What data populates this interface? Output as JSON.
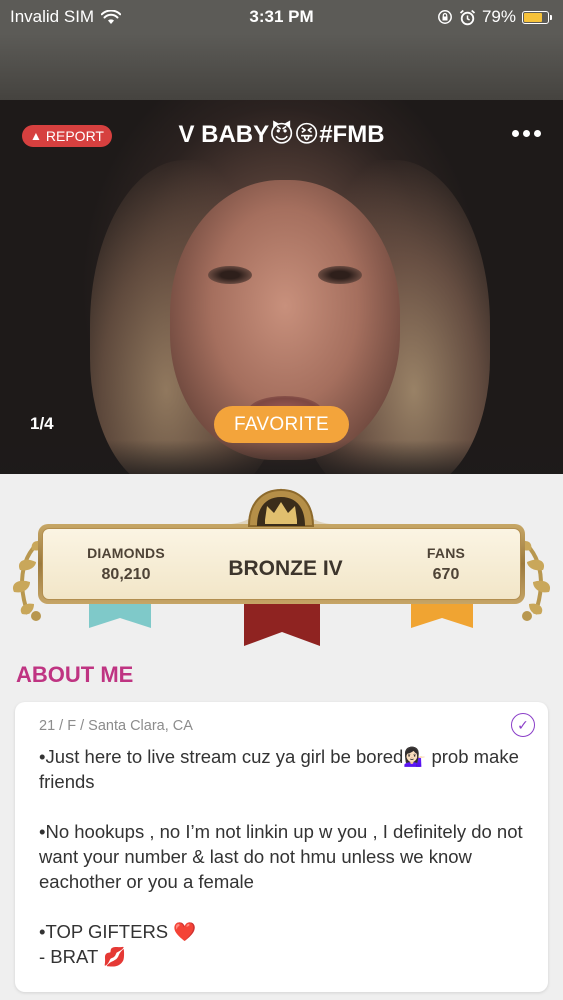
{
  "status_bar": {
    "carrier": "Invalid SIM",
    "time": "3:31 PM",
    "battery": "79%",
    "battery_level": 0.79,
    "icons": [
      "wifi-icon",
      "orientation-lock-icon",
      "alarm-icon",
      "battery-icon"
    ]
  },
  "profile": {
    "report_label": "REPORT",
    "display_name": "V BABY😈😝#FMB",
    "photo_counter": "1/4",
    "favorite_label": "FAVORITE"
  },
  "rank": {
    "diamonds_label": "DIAMONDS",
    "diamonds_value": "80,210",
    "tier": "BRONZE IV",
    "fans_label": "FANS",
    "fans_value": "670"
  },
  "about": {
    "heading": "ABOUT ME",
    "meta": "21 / F / Santa Clara, CA",
    "line1": "•Just here to live stream cuz ya girl be bored💁🏻‍♀️ prob make friends",
    "line2": "•No hookups , no I’m not linkin up w you , I definitely do not want your number & last do not hmu unless we know eachother or you a female",
    "line3": "•TOP GIFTERS ❤️",
    "line4": "- BRAT 💋"
  },
  "colors": {
    "report": "#d6403f",
    "favorite": "#f3a43b",
    "about_heading": "#bf3482",
    "verified": "#8a3ec8",
    "ribbon_teal": "#7fc9c9",
    "ribbon_red": "#8f2321",
    "ribbon_orange": "#f0a432"
  }
}
